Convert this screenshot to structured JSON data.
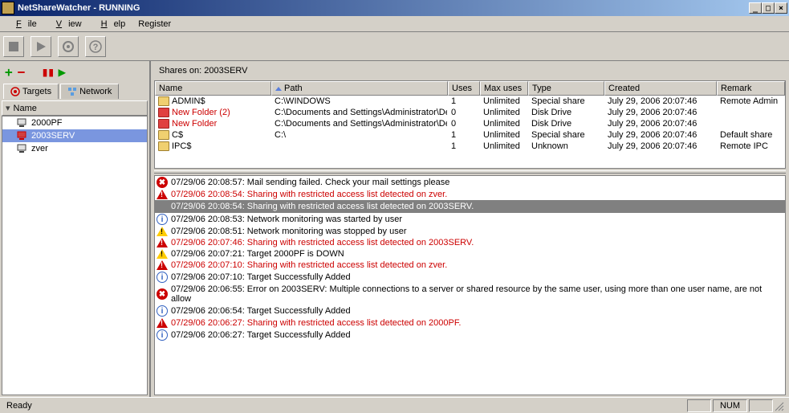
{
  "window": {
    "title": "NetShareWatcher - RUNNING"
  },
  "menu": {
    "file": "File",
    "view": "View",
    "help": "Help",
    "register": "Register"
  },
  "left": {
    "tabs": {
      "targets": "Targets",
      "network": "Network"
    },
    "header": "Name",
    "items": [
      {
        "name": "2000PF"
      },
      {
        "name": "2003SERV"
      },
      {
        "name": "zver"
      }
    ]
  },
  "shares": {
    "label": "Shares on: 2003SERV",
    "columns": {
      "name": "Name",
      "path": "Path",
      "uses": "Uses",
      "max": "Max uses",
      "type": "Type",
      "created": "Created",
      "remark": "Remark"
    },
    "rows": [
      {
        "icon": "y",
        "name": "ADMIN$",
        "path": "C:\\WINDOWS",
        "uses": "1",
        "max": "Unlimited",
        "type": "Special share",
        "created": "July 29, 2006 20:07:46",
        "remark": "Remote Admin"
      },
      {
        "icon": "r",
        "name": "New Folder (2)",
        "path": "C:\\Documents and Settings\\Administrator\\Des",
        "uses": "0",
        "max": "Unlimited",
        "type": "Disk Drive",
        "created": "July 29, 2006 20:07:46",
        "remark": ""
      },
      {
        "icon": "r",
        "name": "New Folder",
        "path": "C:\\Documents and Settings\\Administrator\\Des",
        "uses": "0",
        "max": "Unlimited",
        "type": "Disk Drive",
        "created": "July 29, 2006 20:07:46",
        "remark": ""
      },
      {
        "icon": "y",
        "name": "C$",
        "path": "C:\\",
        "uses": "1",
        "max": "Unlimited",
        "type": "Special share",
        "created": "July 29, 2006 20:07:46",
        "remark": "Default share"
      },
      {
        "icon": "y",
        "name": "IPC$",
        "path": "",
        "uses": "1",
        "max": "Unlimited",
        "type": "Unknown",
        "created": "July 29, 2006 20:07:46",
        "remark": "Remote IPC"
      }
    ]
  },
  "log": [
    {
      "icon": "err",
      "red": false,
      "text": "07/29/06 20:08:57: Mail sending failed. Check your mail settings please"
    },
    {
      "icon": "warn-r",
      "red": true,
      "text": "07/29/06 20:08:54: Sharing with restricted access list detected on zver."
    },
    {
      "icon": "",
      "red": false,
      "sel": true,
      "text": "07/29/06 20:08:54: Sharing with restricted access list detected on 2003SERV."
    },
    {
      "icon": "info",
      "red": false,
      "text": "07/29/06 20:08:53: Network monitoring was started by user"
    },
    {
      "icon": "warn",
      "red": false,
      "text": "07/29/06 20:08:51: Network monitoring was stopped by user"
    },
    {
      "icon": "warn-r",
      "red": true,
      "text": "07/29/06 20:07:46: Sharing with restricted access list detected on 2003SERV."
    },
    {
      "icon": "warn",
      "red": false,
      "text": "07/29/06 20:07:21: Target 2000PF is DOWN"
    },
    {
      "icon": "warn-r",
      "red": true,
      "text": "07/29/06 20:07:10: Sharing with restricted access list detected on zver."
    },
    {
      "icon": "info",
      "red": false,
      "text": "07/29/06 20:07:10: Target Successfully Added"
    },
    {
      "icon": "err",
      "red": false,
      "text": "07/29/06 20:06:55: Error on 2003SERV: Multiple connections to a server or shared resource by the same user, using more than one user name, are not allow"
    },
    {
      "icon": "info",
      "red": false,
      "text": "07/29/06 20:06:54: Target Successfully Added"
    },
    {
      "icon": "warn-r",
      "red": true,
      "text": "07/29/06 20:06:27: Sharing with restricted access list detected on 2000PF."
    },
    {
      "icon": "info",
      "red": false,
      "text": "07/29/06 20:06:27: Target Successfully Added"
    }
  ],
  "status": {
    "ready": "Ready",
    "num": "NUM"
  }
}
